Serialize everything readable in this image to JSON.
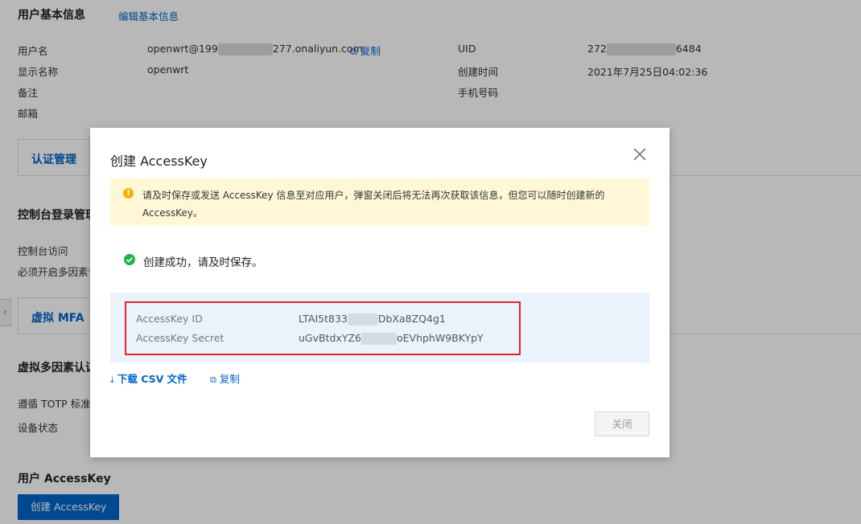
{
  "page": {
    "basic_info_title": "用户基本信息",
    "edit_link": "编辑基本信息",
    "left_fields": [
      {
        "label": "用户名",
        "value_prefix": "openwrt@199",
        "value_suffix": "277.onaliyun.com",
        "copy": "复制"
      },
      {
        "label": "显示名称",
        "value": "openwrt"
      },
      {
        "label": "备注",
        "value": ""
      },
      {
        "label": "邮箱",
        "value": ""
      }
    ],
    "right_fields": [
      {
        "label": "UID",
        "value_prefix": "272",
        "value_suffix": "6484"
      },
      {
        "label": "创建时间",
        "value": "2021年7月25日04:02:36"
      },
      {
        "label": "手机号码",
        "value": ""
      }
    ],
    "tab_auth": "认证管理",
    "console_login_title": "控制台登录管理",
    "console_access": "控制台访问",
    "mfa_required": "必须开启多因素认",
    "tab_mfa": "虚拟 MFA",
    "mfa_title": "虚拟多因素认证",
    "totp": "遵循 TOTP 标准算",
    "device_status": "设备状态",
    "accesskey_title": "用户 AccessKey",
    "create_button": "创建 AccessKey"
  },
  "modal": {
    "title": "创建 AccessKey",
    "warning": "请及时保存或发送 AccessKey 信息至对应用户，弹窗关闭后将无法再次获取该信息，但您可以随时创建新的 AccessKey。",
    "success": "创建成功，请及时保存。",
    "key_id_label": "AccessKey ID",
    "key_id_prefix": "LTAI5t833",
    "key_id_suffix": "DbXa8ZQ4g1",
    "secret_label": "AccessKey Secret",
    "secret_prefix": "uGvBtdxYZ6",
    "secret_suffix": "oEVhphW9BKYpY",
    "download": "下载 CSV 文件",
    "copy": "复制",
    "close": "关闭"
  },
  "colors": {
    "primary": "#0064c8",
    "warning_bg": "#fff7d6",
    "key_bg": "#eaf3fb",
    "highlight": "#e0262b",
    "success": "#1fb54b"
  },
  "icons": [
    "copy-icon",
    "close-icon",
    "warning-icon",
    "check-circle-icon",
    "download-icon",
    "chevron-left-icon"
  ]
}
